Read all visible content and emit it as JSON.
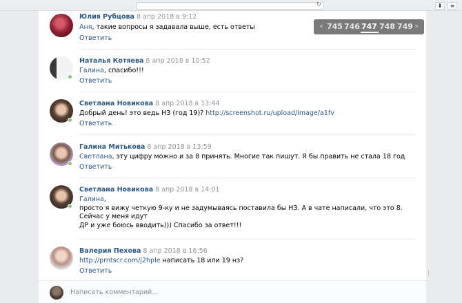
{
  "browser": {
    "reload_icon": "reload-icon",
    "download_icon": "download-icon",
    "menu_icon": "menu-icon"
  },
  "pagination": {
    "prev": "«",
    "pages": [
      "745",
      "746",
      "747",
      "748",
      "749"
    ],
    "current": "747",
    "next": "»"
  },
  "comments": [
    {
      "author": "Юлия Рубцова",
      "date": "8 апр 2018 в 9:12",
      "addressee": "Аня",
      "text": ", такие вопросы я задавала выше, есть ответы",
      "reply": "Ответить",
      "online": false
    },
    {
      "author": "Наталья Котяева",
      "date": "8 апр 2018 в 10:52",
      "addressee": "Галина",
      "text": ", спасибо!!!",
      "reply": "Ответить",
      "online": true
    },
    {
      "author": "Светлана Новикова",
      "date": "8 апр 2018 в 13:44",
      "text": "Добрый день! это ведь НЗ (год 19)? ",
      "link": "http://screenshot.ru/upload/image/a1fv",
      "reply": "Ответить",
      "online": true
    },
    {
      "author": "Галина Митькова",
      "date": "8 апр 2018 в 13:59",
      "addressee": "Светлана",
      "text": ", эту цифру можно и за 8 принять. Многие так пишут. Я бы править не стала 18 год",
      "reply": "Ответить",
      "online": true
    },
    {
      "author": "Светлана Новикова",
      "date": "8 апр 2018 в 14:01",
      "addressee": "Галина",
      "text_line1": ",",
      "text_line2": "просто я вижу четкую 9-ку и не задумываясь поставила бы НЗ. А в чате написали, что это 8. Сейчас у меня идут",
      "text_line3": "ДР и уже боюсь вводить))) Спасибо за ответ!!!",
      "reply": "Ответить",
      "online": true
    },
    {
      "author": "Валерия Пехова",
      "date": "8 апр 2018 в 16:56",
      "link": "http://prntscr.com/j2hple",
      "text": " написать 18 или 19 нз?",
      "reply": "Ответить",
      "online": false
    }
  ],
  "comment_box": {
    "placeholder": "Написать комментарий..."
  },
  "colors": {
    "link": "#2a5885",
    "date": "#939393",
    "online": "#8ac176",
    "pager_bg": "#7a7a7a"
  }
}
